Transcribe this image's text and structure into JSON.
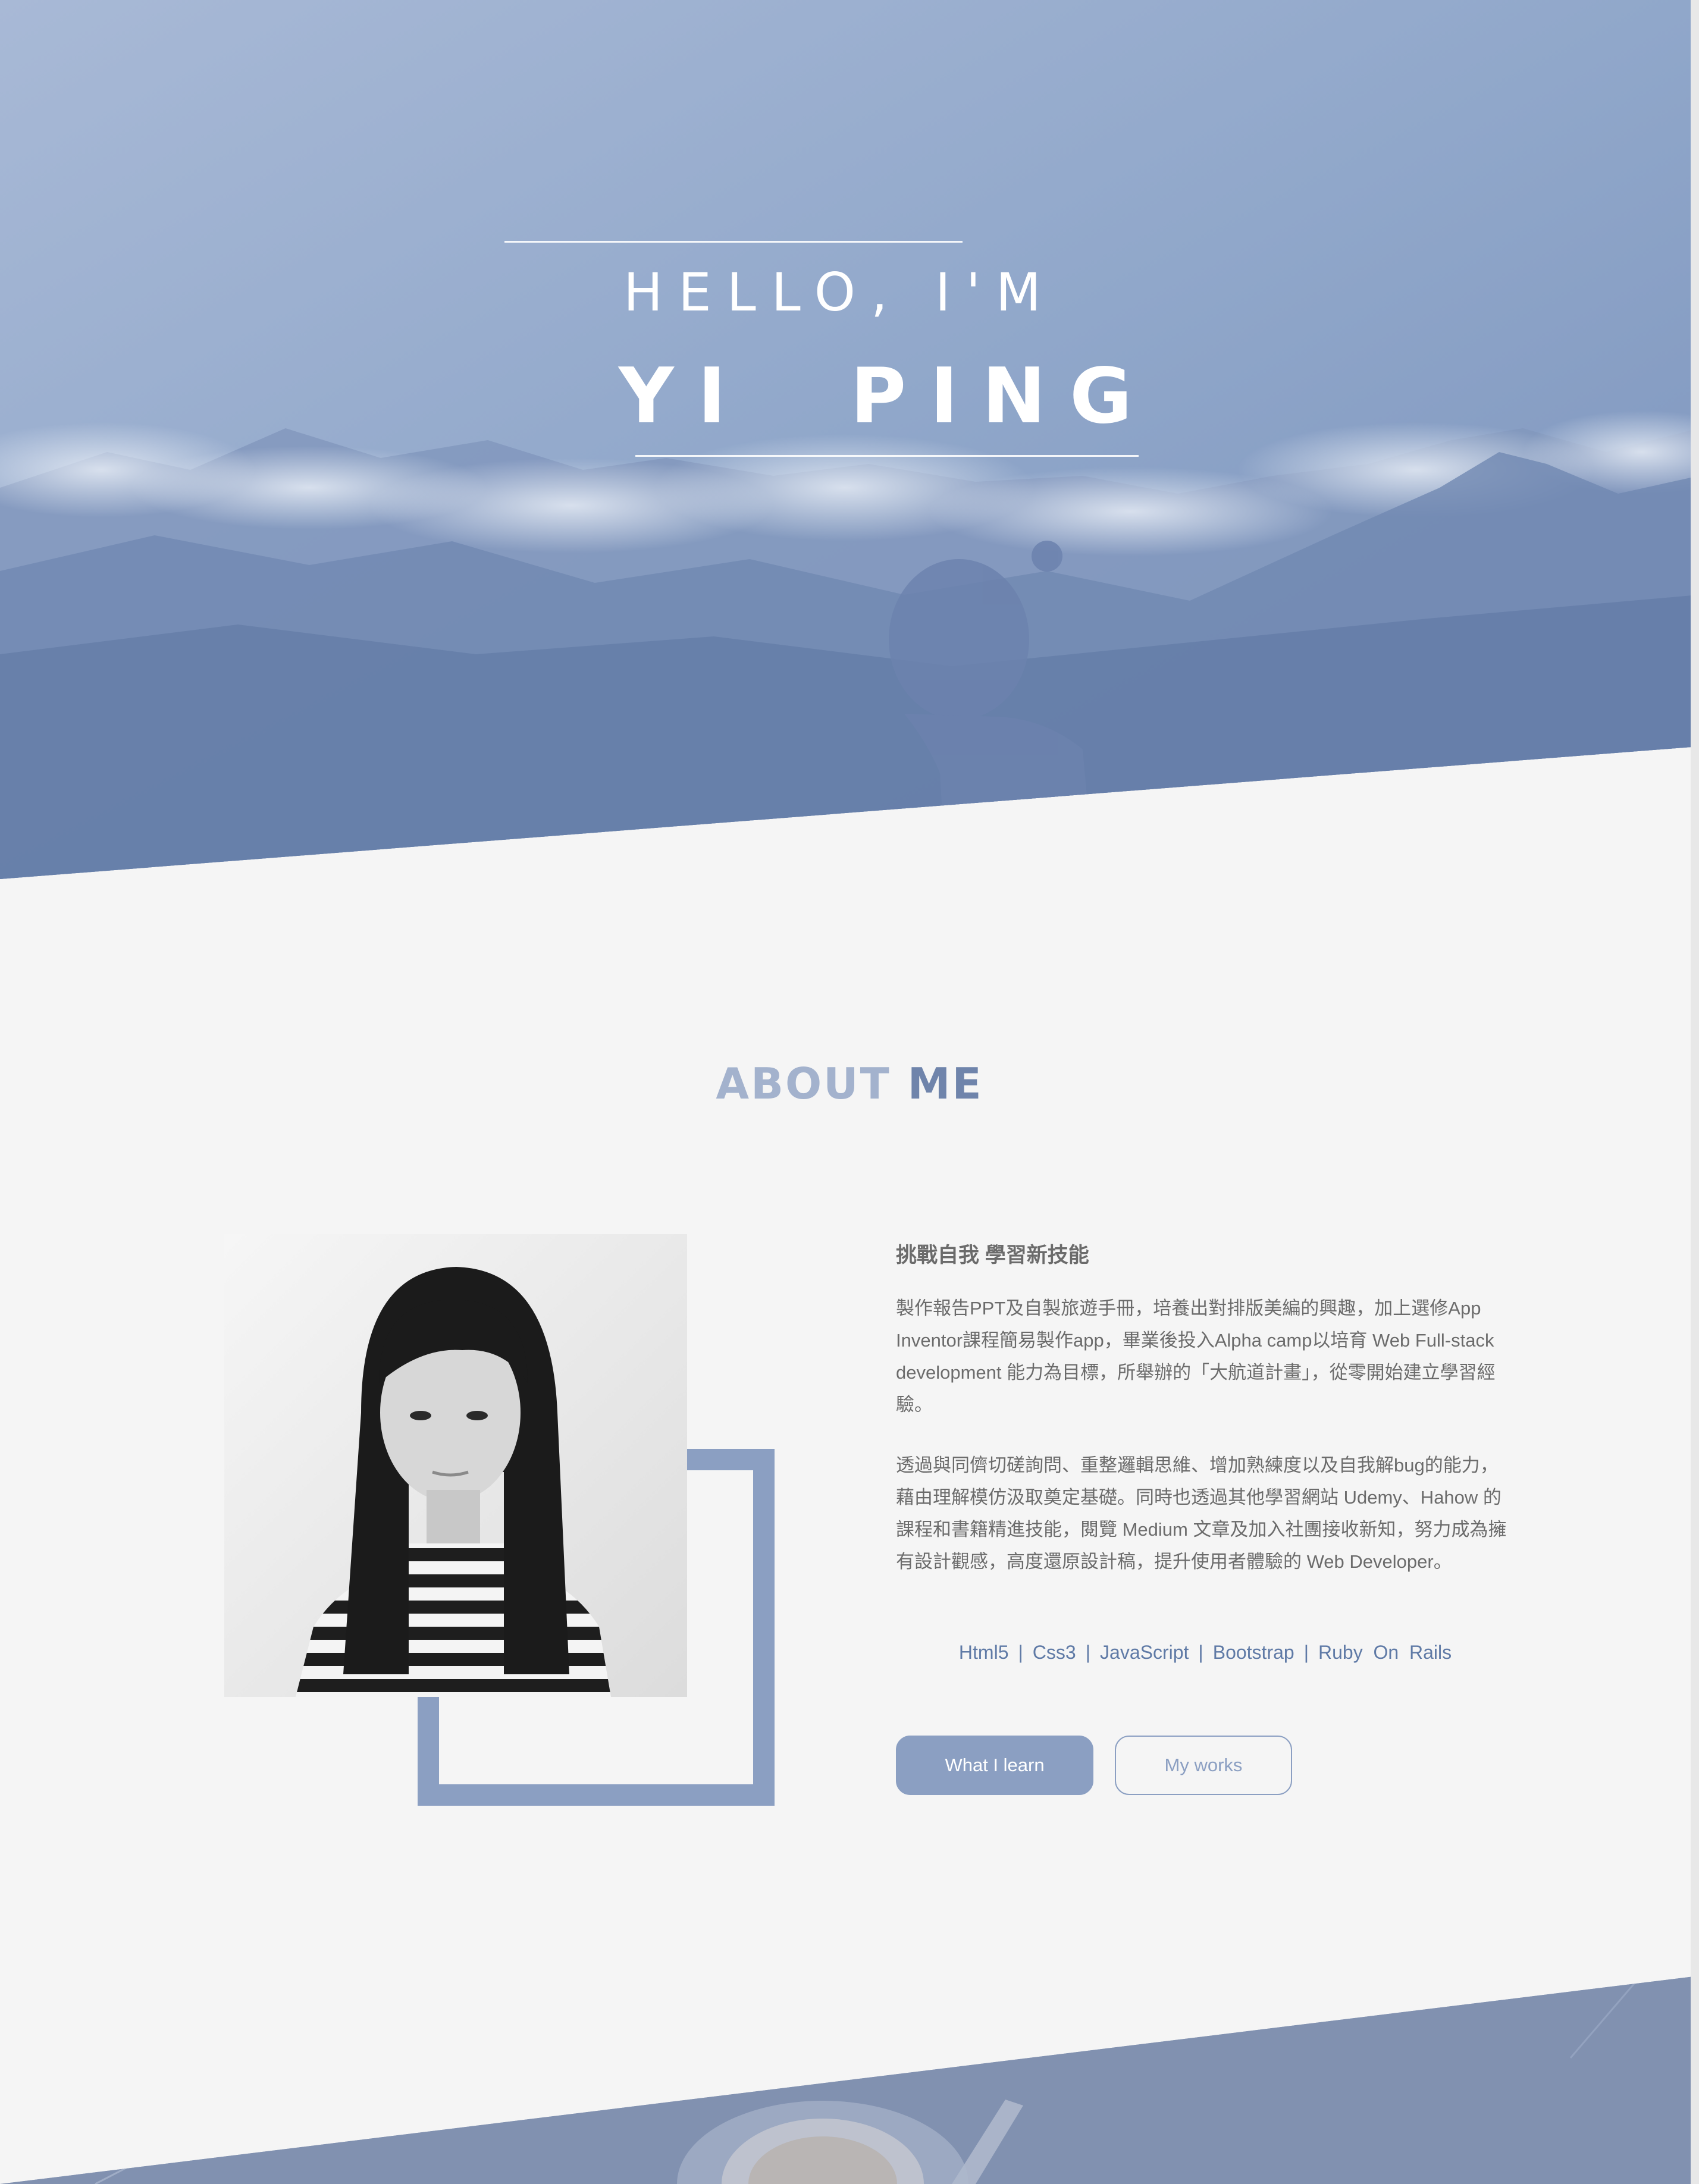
{
  "colors": {
    "accent": "#8b9fc2",
    "accent_dark": "#6f84ab",
    "text": "#6b6b6b",
    "skill_text": "#5f7aa6",
    "background": "#f5f5f5"
  },
  "hero": {
    "greeting": "HELLO, I'M",
    "name": "YI  PING"
  },
  "about": {
    "title_part1": "ABOUT",
    "title_part2": " ME",
    "heading": "挑戰自我 學習新技能",
    "paragraph1": "製作報告PPT及自製旅遊手冊，培養出對排版美編的興趣，加上選修App Inventor課程簡易製作app，畢業後投入Alpha camp以培育 Web Full-stack development 能力為目標，所舉辦的「大航道計畫」，從零開始建立學習經驗。",
    "paragraph2": "透過與同儕切磋詢問、重整邏輯思維、增加熟練度以及自我解bug的能力，藉由理解模仿汲取奠定基礎。同時也透過其他學習網站 Udemy、Hahow 的課程和書籍精進技能，閱覽 Medium 文章及加入社團接收新知，努力成為擁有設計觀感，高度還原設計稿，提升使用者體驗的 Web Developer。",
    "skills": [
      "Html5",
      "Css3",
      "JavaScript",
      "Bootstrap",
      "Ruby  On  Rails"
    ],
    "skill_separator": "|",
    "buttons": {
      "primary": "What I learn",
      "secondary": "My works"
    }
  },
  "icons": {
    "portrait": "portrait-photo",
    "hero_background": "mountain-landscape-photo",
    "bottom_background": "coffee-cup-photo"
  }
}
